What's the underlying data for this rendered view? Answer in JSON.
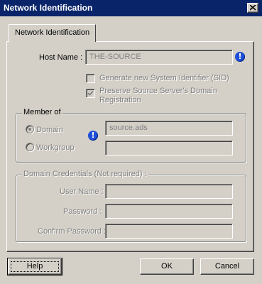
{
  "window": {
    "title": "Network Identification"
  },
  "tabs": [
    {
      "label": "Network Identification",
      "active": true
    }
  ],
  "host": {
    "label": "Host Name :",
    "value": "THE-SOURCE",
    "info_icon": "info-icon"
  },
  "options": {
    "generate_sid": {
      "label": "Generate new System Identifier (SID)",
      "checked": false,
      "enabled": false
    },
    "preserve_domain": {
      "label_line1": "Preserve Source Server's Domain",
      "label_line2": "Registration",
      "checked": true,
      "enabled": false
    }
  },
  "member_of": {
    "title": "Member of",
    "domain_label": "Domain",
    "workgroup_label": "Workgroup",
    "selected": "Domain",
    "domain_value": "source.ads",
    "workgroup_value": "",
    "info_icon": "info-icon"
  },
  "credentials": {
    "title": "Domain Credentials (Not required) :",
    "user_name_label": "User Name :",
    "password_label": "Password :",
    "confirm_password_label": "Confirm Password :",
    "user_name_value": "",
    "password_value": "",
    "confirm_password_value": ""
  },
  "buttons": {
    "help": "Help",
    "ok": "OK",
    "cancel": "Cancel"
  },
  "colors": {
    "titlebar": "#0a246a",
    "face": "#d4d0c8",
    "info": "#1f4fd8",
    "disabled_text": "#808080"
  }
}
